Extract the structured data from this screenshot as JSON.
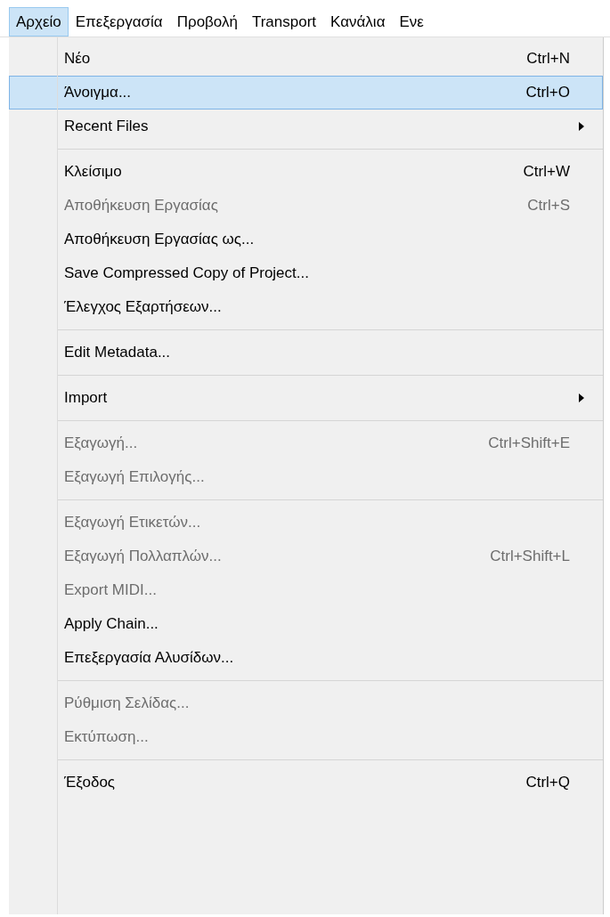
{
  "menubar": [
    {
      "label": "Αρχείο",
      "selected": true
    },
    {
      "label": "Επεξεργασία",
      "selected": false
    },
    {
      "label": "Προβολή",
      "selected": false
    },
    {
      "label": "Transport",
      "selected": false
    },
    {
      "label": "Κανάλια",
      "selected": false
    },
    {
      "label": "Ενε",
      "selected": false
    }
  ],
  "menu": {
    "items": [
      {
        "kind": "item",
        "label": "Νέο",
        "shortcut": "Ctrl+N",
        "disabled": false,
        "selected": false
      },
      {
        "kind": "item",
        "label": "Άνοιγμα...",
        "shortcut": "Ctrl+O",
        "disabled": false,
        "selected": true
      },
      {
        "kind": "submenu",
        "label": "Recent Files",
        "disabled": false,
        "selected": false
      },
      {
        "kind": "separator"
      },
      {
        "kind": "item",
        "label": "Κλείσιμο",
        "shortcut": "Ctrl+W",
        "disabled": false,
        "selected": false
      },
      {
        "kind": "item",
        "label": "Αποθήκευση Εργασίας",
        "shortcut": "Ctrl+S",
        "disabled": true,
        "selected": false
      },
      {
        "kind": "item",
        "label": "Αποθήκευση Εργασίας ως...",
        "disabled": false,
        "selected": false
      },
      {
        "kind": "item",
        "label": "Save Compressed Copy of Project...",
        "disabled": false,
        "selected": false
      },
      {
        "kind": "item",
        "label": "Έλεγχος Εξαρτήσεων...",
        "disabled": false,
        "selected": false
      },
      {
        "kind": "separator"
      },
      {
        "kind": "item",
        "label": "Edit Metadata...",
        "disabled": false,
        "selected": false
      },
      {
        "kind": "separator"
      },
      {
        "kind": "submenu",
        "label": "Import",
        "disabled": false,
        "selected": false
      },
      {
        "kind": "separator"
      },
      {
        "kind": "item",
        "label": "Εξαγωγή...",
        "shortcut": "Ctrl+Shift+E",
        "disabled": true,
        "selected": false
      },
      {
        "kind": "item",
        "label": "Εξαγωγή Επιλογής...",
        "disabled": true,
        "selected": false
      },
      {
        "kind": "separator"
      },
      {
        "kind": "item",
        "label": "Εξαγωγή Ετικετών...",
        "disabled": true,
        "selected": false
      },
      {
        "kind": "item",
        "label": "Εξαγωγή Πολλαπλών...",
        "shortcut": "Ctrl+Shift+L",
        "disabled": true,
        "selected": false
      },
      {
        "kind": "item",
        "label": "Export MIDI...",
        "disabled": true,
        "selected": false
      },
      {
        "kind": "item",
        "label": "Apply Chain...",
        "disabled": false,
        "selected": false
      },
      {
        "kind": "item",
        "label": "Επεξεργασία Αλυσίδων...",
        "disabled": false,
        "selected": false
      },
      {
        "kind": "separator"
      },
      {
        "kind": "item",
        "label": "Ρύθμιση Σελίδας...",
        "disabled": true,
        "selected": false
      },
      {
        "kind": "item",
        "label": "Εκτύπωση...",
        "disabled": true,
        "selected": false
      },
      {
        "kind": "separator"
      },
      {
        "kind": "item",
        "label": "Έξοδος",
        "shortcut": "Ctrl+Q",
        "disabled": false,
        "selected": false
      }
    ]
  }
}
